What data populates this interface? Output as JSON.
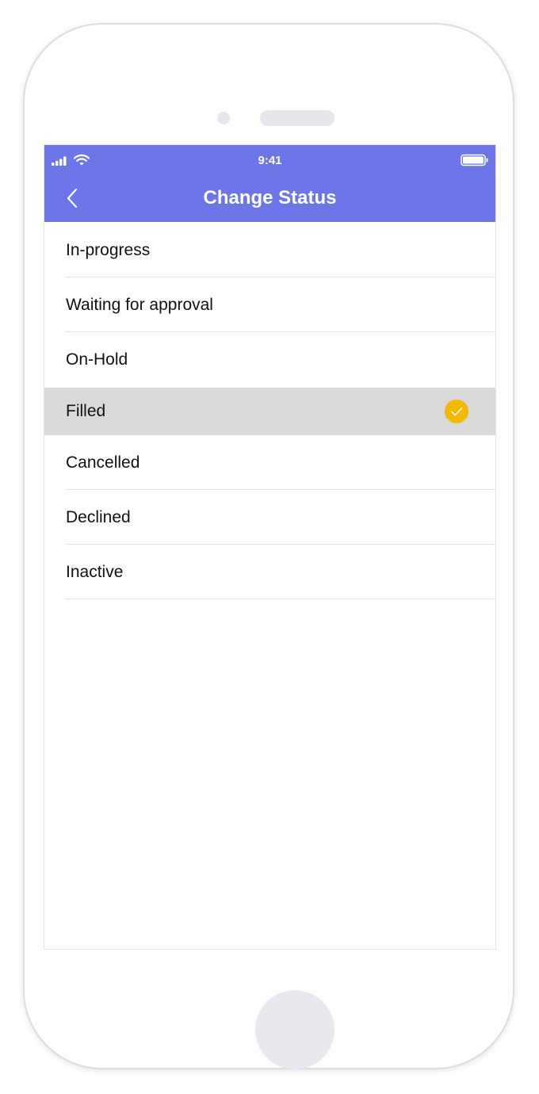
{
  "status_bar": {
    "time": "9:41",
    "signal_icon": "cellular-signal-icon",
    "wifi_icon": "wifi-icon",
    "battery_icon": "battery-icon"
  },
  "nav": {
    "title": "Change Status",
    "back_icon": "chevron-left-icon"
  },
  "colors": {
    "header": "#6c76e8",
    "selected_row": "#d9d9d9",
    "check": "#f5b800"
  },
  "statuses": [
    {
      "label": "In-progress",
      "selected": false
    },
    {
      "label": "Waiting for approval",
      "selected": false
    },
    {
      "label": "On-Hold",
      "selected": false
    },
    {
      "label": "Filled",
      "selected": true
    },
    {
      "label": "Cancelled",
      "selected": false
    },
    {
      "label": "Declined",
      "selected": false
    },
    {
      "label": "Inactive",
      "selected": false
    }
  ]
}
